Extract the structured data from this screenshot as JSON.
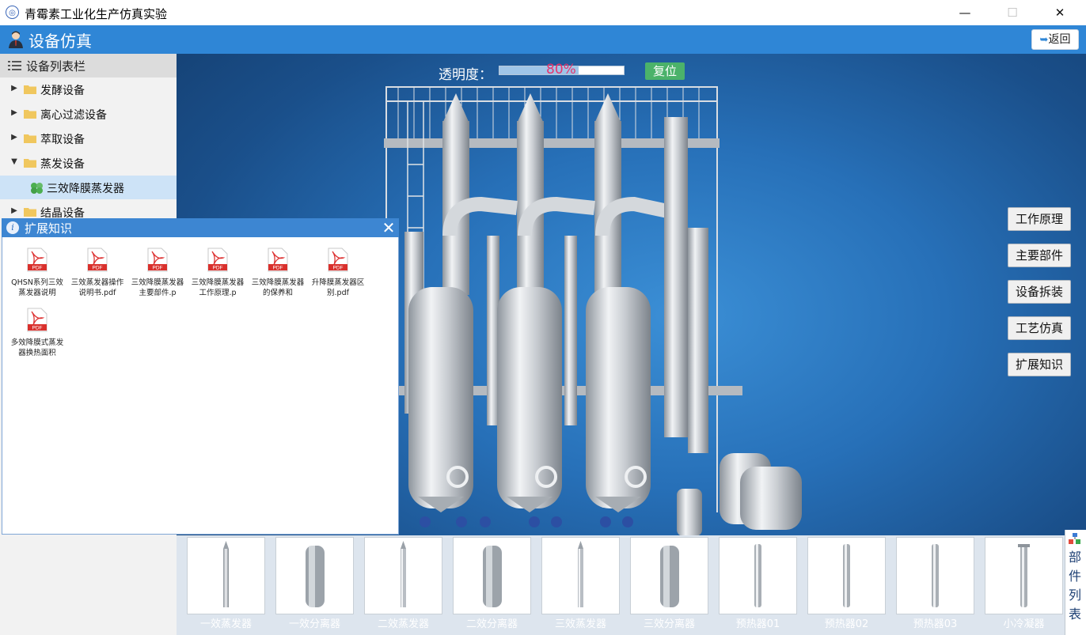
{
  "window": {
    "title": "青霉素工业化生产仿真实验",
    "minimize": "—",
    "maximize": "☐",
    "close": "✕"
  },
  "header": {
    "title": "设备仿真",
    "back_label": "返回"
  },
  "sidebar": {
    "title": "设备列表栏",
    "items": [
      {
        "label": "发酵设备",
        "expanded": false
      },
      {
        "label": "离心过滤设备",
        "expanded": false
      },
      {
        "label": "萃取设备",
        "expanded": false
      },
      {
        "label": "蒸发设备",
        "expanded": true,
        "children": [
          {
            "label": "三效降膜蒸发器",
            "selected": true
          }
        ]
      },
      {
        "label": "结晶设备",
        "expanded": false
      }
    ]
  },
  "scene": {
    "opacity_label": "透明度：",
    "opacity_value": "80%",
    "opacity_fraction": 0.8,
    "reset_label": "复位"
  },
  "side_buttons": [
    "工作原理",
    "主要部件",
    "设备拆装",
    "工艺仿真",
    "扩展知识"
  ],
  "knowledge_popup": {
    "title": "扩展知识",
    "files": [
      "QHSN系列三效蒸发器说明",
      "三效蒸发器操作说明书.pdf",
      "三效降膜蒸发器主要部件.p",
      "三效降膜蒸发器工作原理.p",
      "三效降膜蒸发器的保养和",
      "升降膜蒸发器区别.pdf",
      "多效降膜式蒸发器换热面积"
    ],
    "pdf_badge": "PDF"
  },
  "parts": {
    "list_label": "部件列表",
    "items": [
      "一效蒸发器",
      "一效分离器",
      "二效蒸发器",
      "二效分离器",
      "三效蒸发器",
      "三效分离器",
      "预热器01",
      "预热器02",
      "预热器03",
      "小冷凝器"
    ]
  },
  "colors": {
    "header_blue": "#2f86d6",
    "popup_header_blue": "#3d86d2",
    "reset_green": "#4bb26a",
    "opacity_text": "#e8336b",
    "scene_blue": "#2770b8"
  }
}
